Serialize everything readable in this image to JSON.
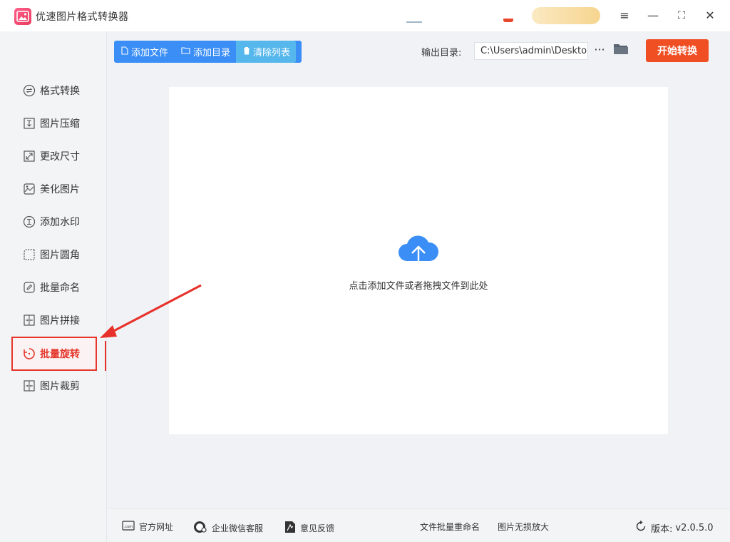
{
  "app": {
    "title": "优速图片格式转换器"
  },
  "window_controls": {
    "menu": "≡",
    "minimize": "—",
    "maximize": "⛶",
    "close": "✕"
  },
  "sidebar": {
    "items": [
      {
        "label": "格式转换",
        "icon": "format-convert-icon"
      },
      {
        "label": "图片压缩",
        "icon": "compress-icon"
      },
      {
        "label": "更改尺寸",
        "icon": "resize-icon"
      },
      {
        "label": "美化图片",
        "icon": "beautify-icon"
      },
      {
        "label": "添加水印",
        "icon": "watermark-icon"
      },
      {
        "label": "图片圆角",
        "icon": "round-corner-icon"
      },
      {
        "label": "批量命名",
        "icon": "rename-icon"
      },
      {
        "label": "图片拼接",
        "icon": "stitch-icon"
      },
      {
        "label": "批量旋转",
        "icon": "rotate-icon",
        "active": true
      },
      {
        "label": "图片裁剪",
        "icon": "crop-icon"
      }
    ]
  },
  "toolbar": {
    "add_file": "添加文件",
    "add_folder": "添加目录",
    "clear_list": "清除列表",
    "output_label": "输出目录:",
    "output_path": "C:\\Users\\admin\\Deskto",
    "more": "···",
    "start": "开始转换"
  },
  "dropzone": {
    "hint": "点击添加文件或者拖拽文件到此处"
  },
  "footer": {
    "website": "官方网址",
    "wechat": "企业微信客服",
    "feedback": "意见反馈",
    "batch_rename": "文件批量重命名",
    "lossless": "图片无损放大",
    "version_label": "版本:",
    "version": "v2.0.5.0"
  },
  "colors": {
    "accent_blue": "#3a8ef6",
    "start_red": "#f04e23",
    "active_red": "#e5362b"
  }
}
